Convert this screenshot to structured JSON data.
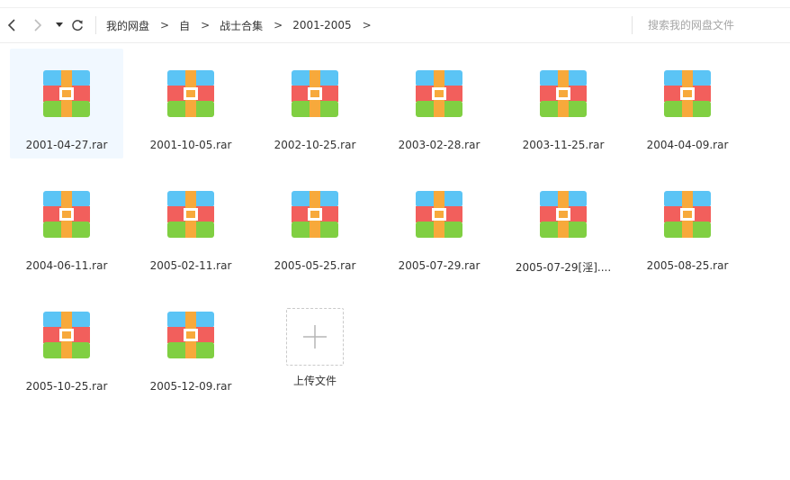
{
  "toolbar": {
    "back_icon": "chevron-left-icon",
    "forward_icon": "chevron-right-icon",
    "history_icon": "caret-down-icon",
    "refresh_icon": "refresh-icon",
    "breadcrumbs": [
      {
        "label": "我的网盘"
      },
      {
        "label": "自"
      },
      {
        "label": "战士合集"
      },
      {
        "label": "2001-2005"
      }
    ],
    "separator": ">",
    "search_placeholder": "搜索我的网盘文件"
  },
  "files": [
    {
      "name": "2001-04-27.rar",
      "selected": true
    },
    {
      "name": "2001-10-05.rar"
    },
    {
      "name": "2002-10-25.rar"
    },
    {
      "name": "2003-02-28.rar"
    },
    {
      "name": "2003-11-25.rar"
    },
    {
      "name": "2004-04-09.rar"
    },
    {
      "name": "2004-06-11.rar"
    },
    {
      "name": "2005-02-11.rar"
    },
    {
      "name": "2005-05-25.rar"
    },
    {
      "name": "2005-07-29.rar"
    },
    {
      "name": "2005-07-29[淫]...."
    },
    {
      "name": "2005-08-25.rar"
    },
    {
      "name": "2005-10-25.rar"
    },
    {
      "name": "2005-12-09.rar"
    }
  ],
  "file_icon": "archive-rar-icon",
  "upload": {
    "label": "上传文件",
    "icon": "plus-icon"
  },
  "colors": {
    "archive_top": "#5bc4f5",
    "archive_middle": "#f25f5c",
    "archive_bottom": "#80cf42",
    "archive_strap": "#f7a93b",
    "selected_bg": "#f1f8ff"
  }
}
